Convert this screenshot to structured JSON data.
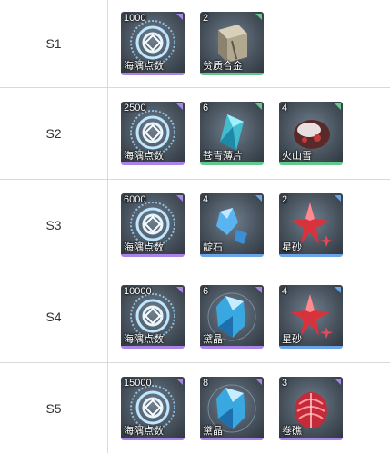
{
  "rows": [
    {
      "stage": "S1",
      "items": [
        {
          "count": "1000",
          "name": "海隅点数",
          "icon": "emblem-icon",
          "quality": "purple"
        },
        {
          "count": "2",
          "name": "贫质合金",
          "icon": "alloy-cube-icon",
          "quality": "green"
        }
      ]
    },
    {
      "stage": "S2",
      "items": [
        {
          "count": "2500",
          "name": "海隅点数",
          "icon": "emblem-icon",
          "quality": "purple"
        },
        {
          "count": "6",
          "name": "苍青薄片",
          "icon": "cyan-shard-icon",
          "quality": "green"
        },
        {
          "count": "4",
          "name": "火山雪",
          "icon": "volcanic-rock-icon",
          "quality": "green"
        }
      ]
    },
    {
      "stage": "S3",
      "items": [
        {
          "count": "6000",
          "name": "海隅点数",
          "icon": "emblem-icon",
          "quality": "purple"
        },
        {
          "count": "4",
          "name": "靛石",
          "icon": "blue-crystal-icon",
          "quality": "blue"
        },
        {
          "count": "2",
          "name": "星砂",
          "icon": "red-star-icon",
          "quality": "blue"
        }
      ]
    },
    {
      "stage": "S4",
      "items": [
        {
          "count": "10000",
          "name": "海隅点数",
          "icon": "emblem-icon",
          "quality": "purple"
        },
        {
          "count": "6",
          "name": "黛晶",
          "icon": "blue-gem-icon",
          "quality": "purple"
        },
        {
          "count": "4",
          "name": "星砂",
          "icon": "red-star-icon",
          "quality": "blue"
        }
      ]
    },
    {
      "stage": "S5",
      "items": [
        {
          "count": "15000",
          "name": "海隅点数",
          "icon": "emblem-icon",
          "quality": "purple"
        },
        {
          "count": "8",
          "name": "黛晶",
          "icon": "blue-gem-icon",
          "quality": "purple"
        },
        {
          "count": "3",
          "name": "卷礁",
          "icon": "red-coral-icon",
          "quality": "purple"
        }
      ]
    }
  ],
  "colors": {
    "purple": "#a983e6",
    "blue": "#6aa4e6",
    "green": "#63c98a",
    "border": "#d9d9d9"
  }
}
